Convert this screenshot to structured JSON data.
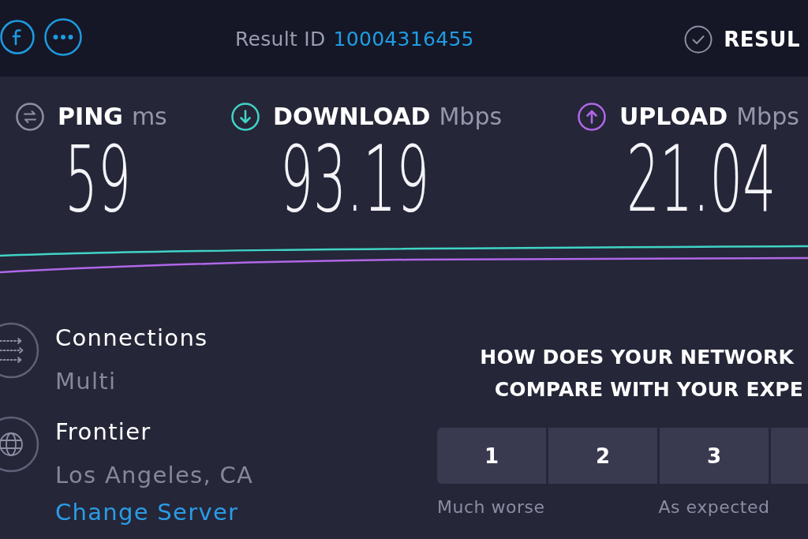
{
  "top_bar": {
    "result_id_label": "Result ID",
    "result_id": "10004316455",
    "results_link": "RESUL"
  },
  "metrics": [
    {
      "kind": "ping",
      "label": "PING",
      "unit": "ms",
      "value": "59"
    },
    {
      "kind": "download",
      "label": "DOWNLOAD",
      "unit": "Mbps",
      "value": "93.19"
    },
    {
      "kind": "upload",
      "label": "UPLOAD",
      "unit": "Mbps",
      "value": "21.04"
    }
  ],
  "info_items": [
    {
      "kind": "connections",
      "title": "Connections",
      "subtitle": "Multi"
    },
    {
      "kind": "server",
      "title": "Frontier",
      "subtitle": "Los Angeles, CA",
      "link": "Change Server"
    }
  ],
  "survey": {
    "question_lines": [
      "HOW DOES YOUR NETWORK",
      "COMPARE WITH YOUR EXPE"
    ],
    "ratings": [
      {
        "kind": "full",
        "label": "1",
        "caption": "Much worse"
      },
      {
        "kind": "full",
        "label": "2"
      },
      {
        "kind": "full",
        "label": "3",
        "caption": "As expected"
      },
      {
        "kind": "cut_off"
      }
    ]
  }
}
